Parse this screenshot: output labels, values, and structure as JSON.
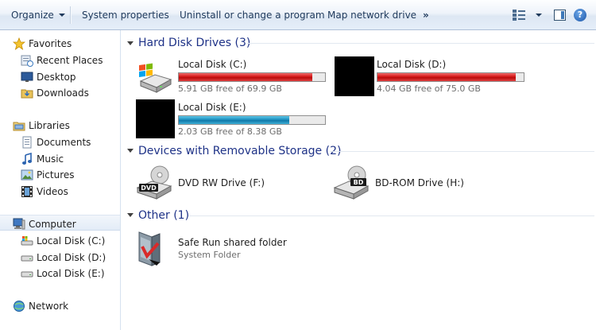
{
  "toolbar": {
    "organize": "Organize",
    "system_properties": "System properties",
    "uninstall": "Uninstall or change a program",
    "map_drive": "Map network drive",
    "more": "»",
    "help": "?"
  },
  "nav": {
    "favorites": "Favorites",
    "recent_places": "Recent Places",
    "desktop": "Desktop",
    "downloads": "Downloads",
    "libraries": "Libraries",
    "documents": "Documents",
    "music": "Music",
    "pictures": "Pictures",
    "videos": "Videos",
    "computer": "Computer",
    "disk_c": "Local Disk (C:)",
    "disk_d": "Local Disk (D:)",
    "disk_e": "Local Disk (E:)",
    "network": "Network"
  },
  "groups": {
    "hdd": "Hard Disk Drives (3)",
    "removable": "Devices with Removable Storage (2)",
    "other": "Other (1)"
  },
  "drives": {
    "c": {
      "name": "Local Disk (C:)",
      "free": "5.91 GB free of 69.9 GB",
      "used_fraction": 0.915
    },
    "d": {
      "name": "Local Disk (D:)",
      "free": "4.04 GB free of 75.0 GB",
      "used_fraction": 0.946
    },
    "e": {
      "name": "Local Disk (E:)",
      "free": "2.03 GB free of 8.38 GB",
      "used_fraction": 0.758
    }
  },
  "removable": {
    "f": {
      "name": "DVD RW Drive (F:)",
      "badge": "DVD"
    },
    "h": {
      "name": "BD-ROM Drive (H:)",
      "badge": "BD"
    }
  },
  "other": {
    "folder": {
      "name": "Safe Run shared folder",
      "type": "System Folder"
    }
  },
  "colors": {
    "accent_text": "#1e3287",
    "bar_full": "#d41616",
    "bar_normal": "#1e8fbf"
  }
}
